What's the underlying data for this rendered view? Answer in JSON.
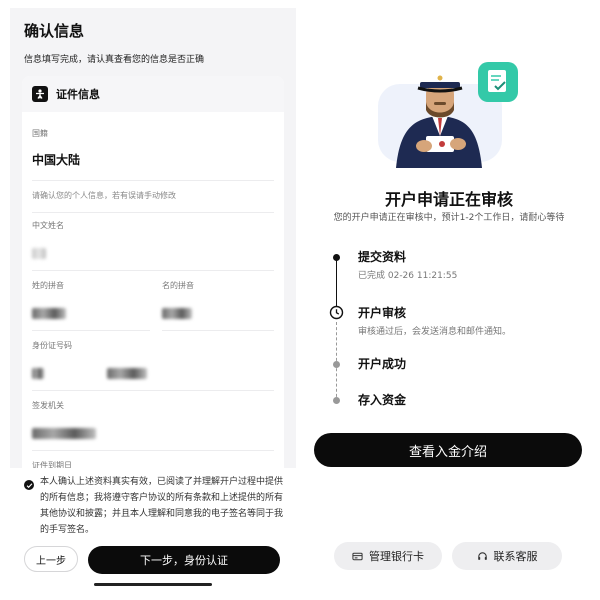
{
  "left": {
    "title": "确认信息",
    "subtitle": "信息填写完成，请认真查看您的信息是否正确",
    "card_header": "证件信息",
    "nationality": {
      "label": "国籍",
      "value": "中国大陆"
    },
    "hint": "请确认您的个人信息，若有误请手动修改",
    "chinese_name": {
      "label": "中文姓名"
    },
    "surname_pinyin": {
      "label": "姓的拼音"
    },
    "given_pinyin": {
      "label": "名的拼音"
    },
    "id_number": {
      "label": "身份证号码"
    },
    "issuer": {
      "label": "签发机关"
    },
    "expiry": {
      "label": "证件到期日"
    },
    "agreement": "本人确认上述资料真实有效，已阅读了并理解开户过程中提供的所有信息；我将遵守客户协议的所有条款和上述提供的所有其他协议和披露；并且本人理解和同意我的电子签名等同于我的手写签名。",
    "prev_button": "上一步",
    "next_button": "下一步，身份认证"
  },
  "right": {
    "title": "开户申请正在审核",
    "subtitle": "您的开户申请正在审核中，预计1-2个工作日，请耐心等待",
    "steps": [
      {
        "name": "提交资料",
        "desc": "已完成 02-26 11:21:55"
      },
      {
        "name": "开户审核",
        "desc": "审核通过后，会发送消息和邮件通知。"
      },
      {
        "name": "开户成功"
      },
      {
        "name": "存入资金"
      }
    ],
    "intro_button": "查看入金介绍",
    "bank_button": "管理银行卡",
    "service_button": "联系客服"
  }
}
